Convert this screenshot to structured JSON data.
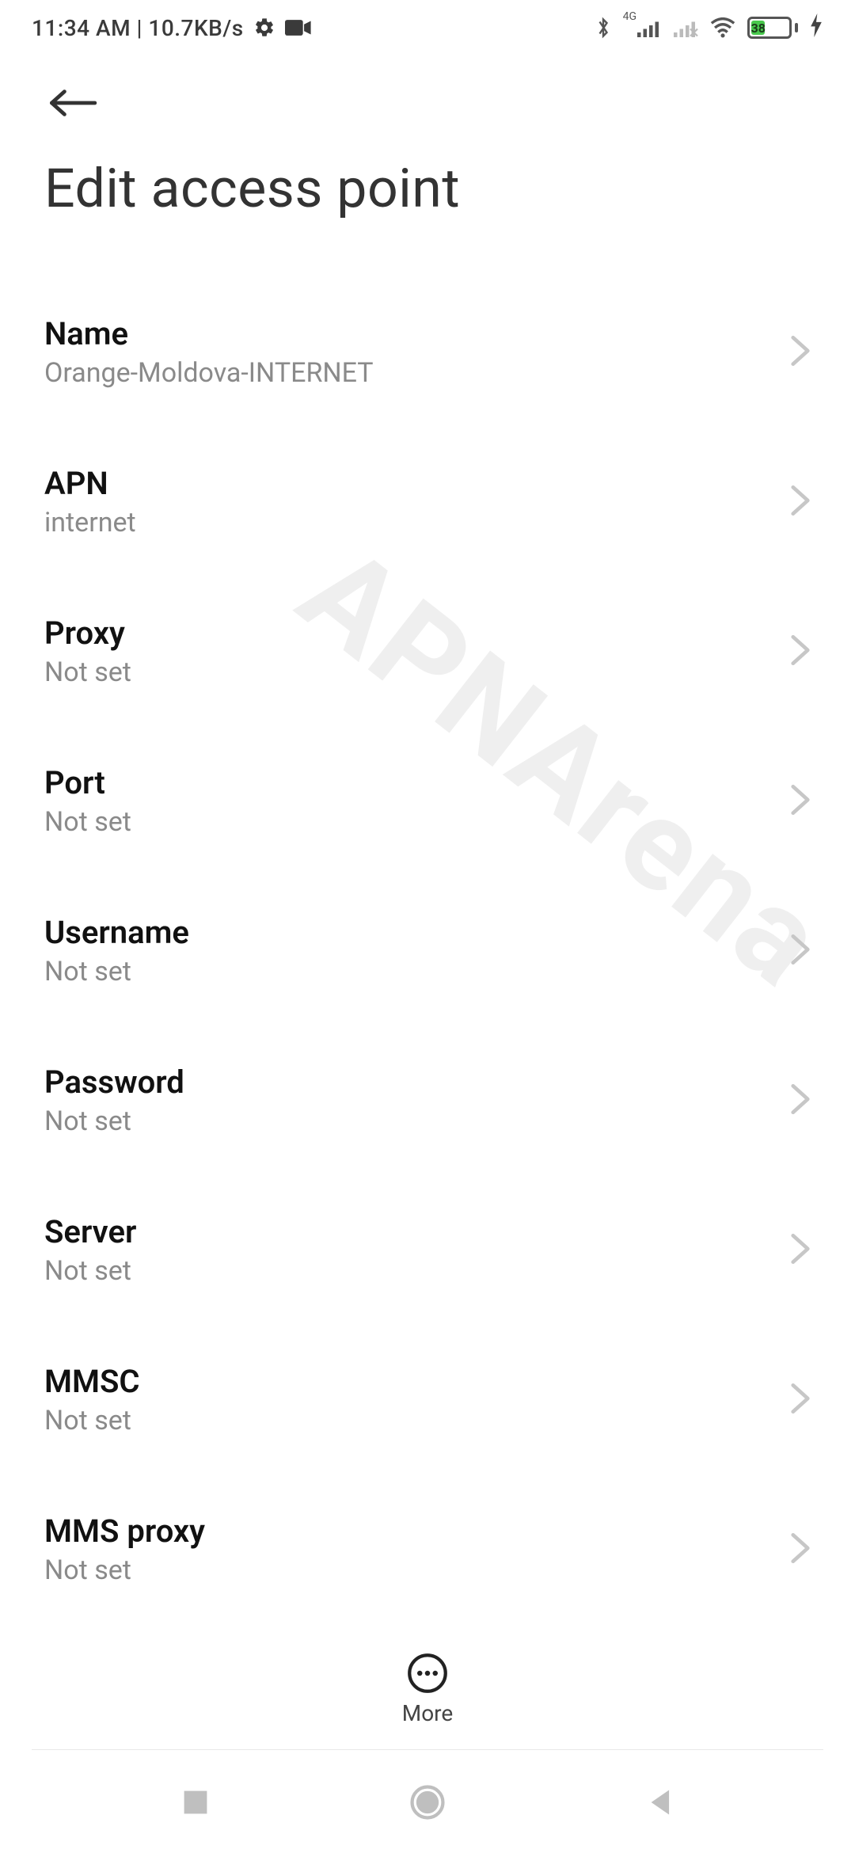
{
  "statusbar": {
    "time_speed": "11:34 AM | 10.7KB/s",
    "battery_pct": "38"
  },
  "header": {
    "title": "Edit access point"
  },
  "settings": [
    {
      "label": "Name",
      "value": "Orange-Moldova-INTERNET"
    },
    {
      "label": "APN",
      "value": "internet"
    },
    {
      "label": "Proxy",
      "value": "Not set"
    },
    {
      "label": "Port",
      "value": "Not set"
    },
    {
      "label": "Username",
      "value": "Not set"
    },
    {
      "label": "Password",
      "value": "Not set"
    },
    {
      "label": "Server",
      "value": "Not set"
    },
    {
      "label": "MMSC",
      "value": "Not set"
    },
    {
      "label": "MMS proxy",
      "value": "Not set"
    }
  ],
  "toolbar": {
    "more_label": "More"
  },
  "watermark": "APNArena"
}
